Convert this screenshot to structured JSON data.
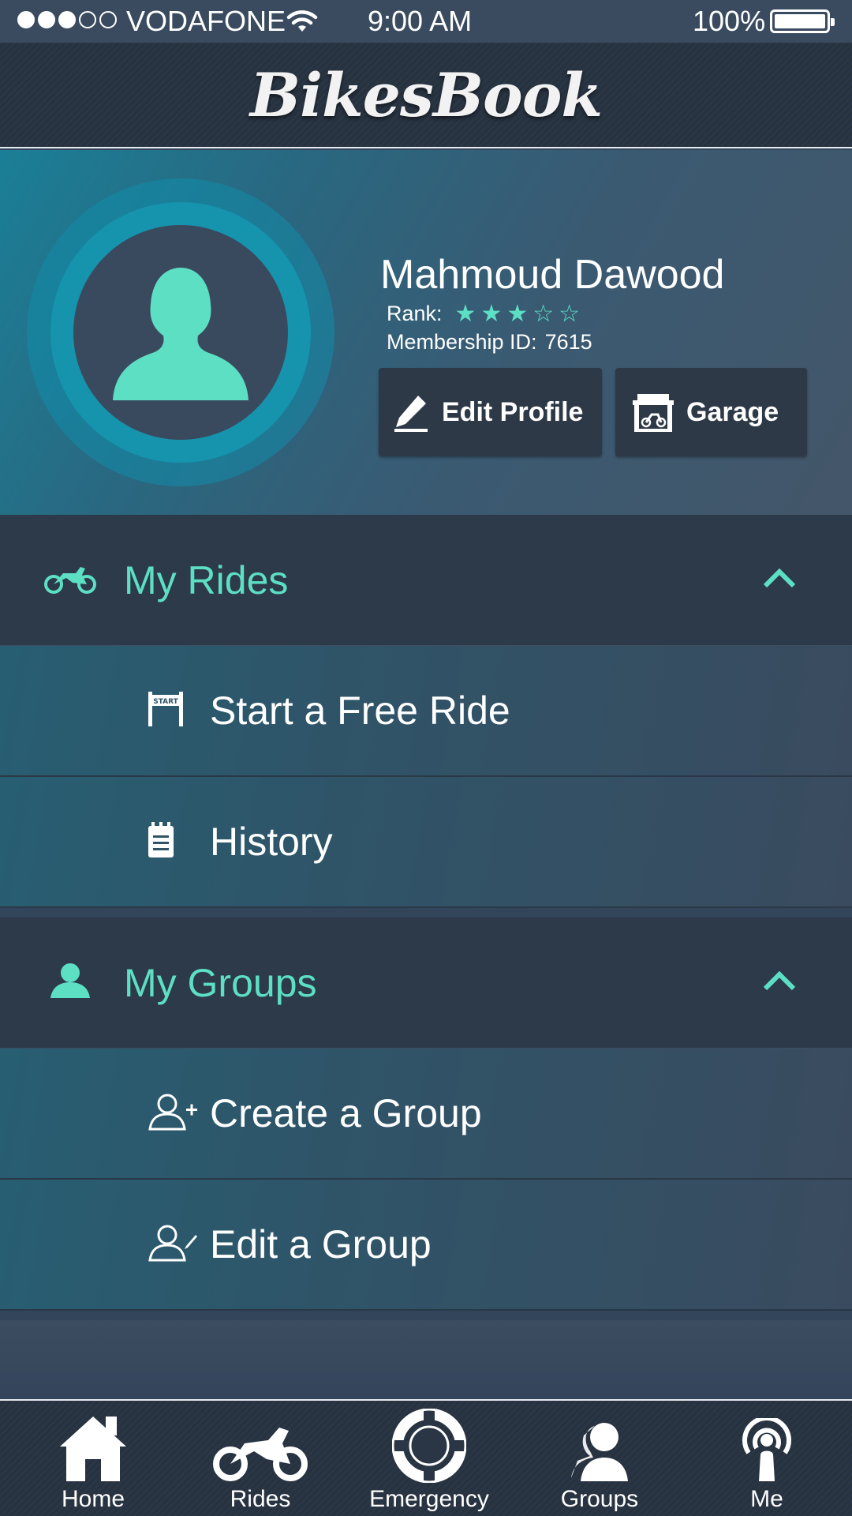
{
  "status_bar": {
    "carrier": "VODAFONE",
    "time": "9:00 AM",
    "battery": "100%",
    "signal_bars_filled": 3,
    "signal_bars_total": 5
  },
  "header": {
    "title": "BikesBook"
  },
  "profile": {
    "name": "Mahmoud Dawood",
    "rank_label": "Rank:",
    "rank_stars": 3,
    "rank_max": 5,
    "membership_label": "Membership ID:",
    "membership_id": "7615",
    "edit_label": "Edit Profile",
    "garage_label": "Garage"
  },
  "sections": [
    {
      "title": "My Rides",
      "icon": "motorbike-icon",
      "expanded": true,
      "items": [
        {
          "label": "Start a Free Ride",
          "icon": "start-banner-icon"
        },
        {
          "label": "History",
          "icon": "notepad-icon"
        }
      ]
    },
    {
      "title": "My Groups",
      "icon": "user-icon",
      "expanded": true,
      "items": [
        {
          "label": "Create a Group",
          "icon": "add-user-icon"
        },
        {
          "label": "Edit a Group",
          "icon": "edit-user-icon"
        }
      ]
    }
  ],
  "tabbar": [
    {
      "label": "Home",
      "icon": "home-icon"
    },
    {
      "label": "Rides",
      "icon": "motorbike-icon"
    },
    {
      "label": "Emergency",
      "icon": "lifebuoy-icon"
    },
    {
      "label": "Groups",
      "icon": "group-icon"
    },
    {
      "label": "Me",
      "icon": "broadcast-user-icon"
    }
  ],
  "colors": {
    "accent": "#5ddfc4",
    "header_bg": "#2a3645",
    "section_bg": "#2c3a4a",
    "avatar_ring": "#1693ad"
  },
  "star_text": {
    "filled": "★",
    "empty": "☆"
  }
}
